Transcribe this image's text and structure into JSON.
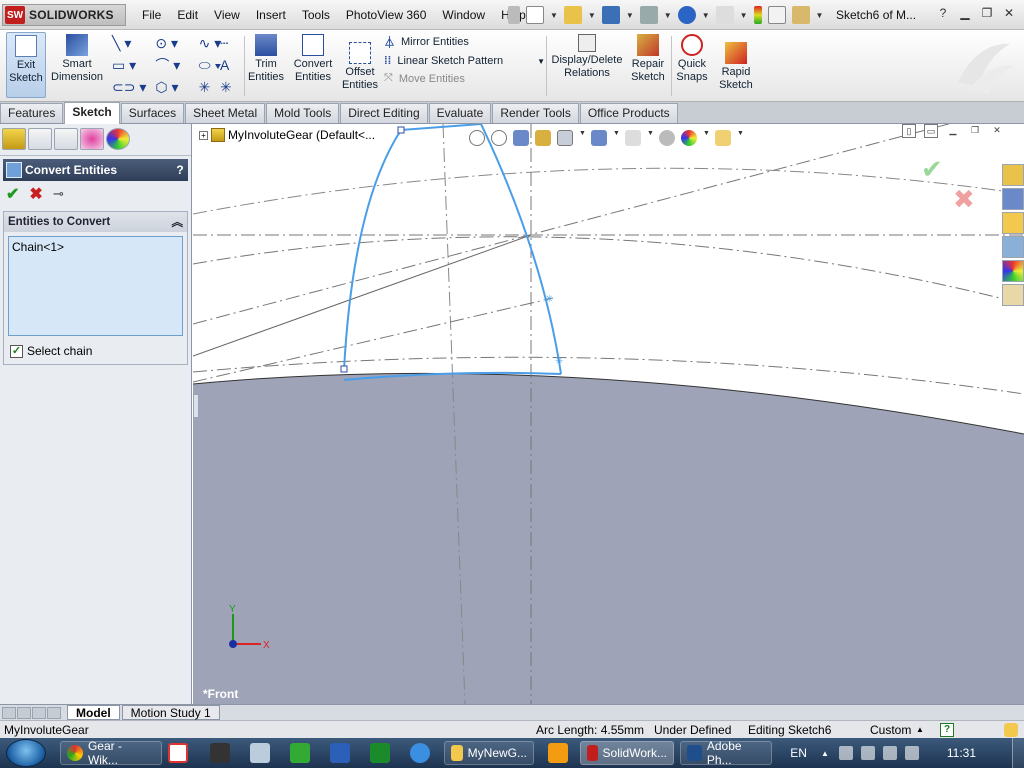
{
  "app": {
    "logo_text": "SOLIDWORKS",
    "logo_mark": "SW",
    "document_title": "Sketch6 of M...",
    "help_label": "?"
  },
  "menu": [
    "File",
    "Edit",
    "View",
    "Insert",
    "Tools",
    "PhotoView 360",
    "Window",
    "Help"
  ],
  "command_manager": {
    "exit_sketch": "Exit\nSketch",
    "smart_dimension": "Smart\nDimension",
    "trim_entities": "Trim\nEntities",
    "convert_entities": "Convert\nEntities",
    "offset_entities": "Offset\nEntities",
    "mirror_entities": "Mirror Entities",
    "linear_sketch_pattern": "Linear Sketch Pattern",
    "move_entities": "Move Entities",
    "display_delete_relations": "Display/Delete\nRelations",
    "repair_sketch": "Repair\nSketch",
    "quick_snaps": "Quick\nSnaps",
    "rapid_sketch": "Rapid\nSketch"
  },
  "tabs": [
    {
      "label": "Features",
      "active": false
    },
    {
      "label": "Sketch",
      "active": true
    },
    {
      "label": "Surfaces",
      "active": false
    },
    {
      "label": "Sheet Metal",
      "active": false
    },
    {
      "label": "Mold Tools",
      "active": false
    },
    {
      "label": "Direct Editing",
      "active": false
    },
    {
      "label": "Evaluate",
      "active": false
    },
    {
      "label": "Render Tools",
      "active": false
    },
    {
      "label": "Office Products",
      "active": false
    }
  ],
  "property_manager": {
    "title": "Convert Entities",
    "help": "?",
    "group_title": "Entities to Convert",
    "selection_item": "Chain<1>",
    "select_chain_label": "Select chain",
    "select_chain_checked": true
  },
  "graphics": {
    "tree_item": "MyInvoluteGear  (Default<...",
    "view_label": "*Front",
    "axis_x": "X",
    "axis_y": "Y"
  },
  "bottom_tabs": [
    {
      "label": "Model",
      "active": true
    },
    {
      "label": "Motion Study 1",
      "active": false
    }
  ],
  "status": {
    "model_name": "MyInvoluteGear",
    "arc_length": "Arc Length: 4.55mm",
    "sketch_state": "Under Defined",
    "editing": "Editing Sketch6",
    "units": "Custom"
  },
  "taskbar": {
    "items": [
      {
        "label": "Gear - Wik...",
        "color": "#e8a21e"
      },
      {
        "label": "MyNewG...",
        "color": "#f2c94c"
      },
      {
        "label": "SolidWork...",
        "color": "#c21e1e"
      },
      {
        "label": "Adobe Ph...",
        "color": "#1e4f8c"
      }
    ],
    "lang": "EN",
    "clock": "11:31"
  },
  "colors": {
    "sketch_blue": "#4a9ee8",
    "gear_body": "#9ea3b8",
    "accent": "#2f3e58"
  }
}
